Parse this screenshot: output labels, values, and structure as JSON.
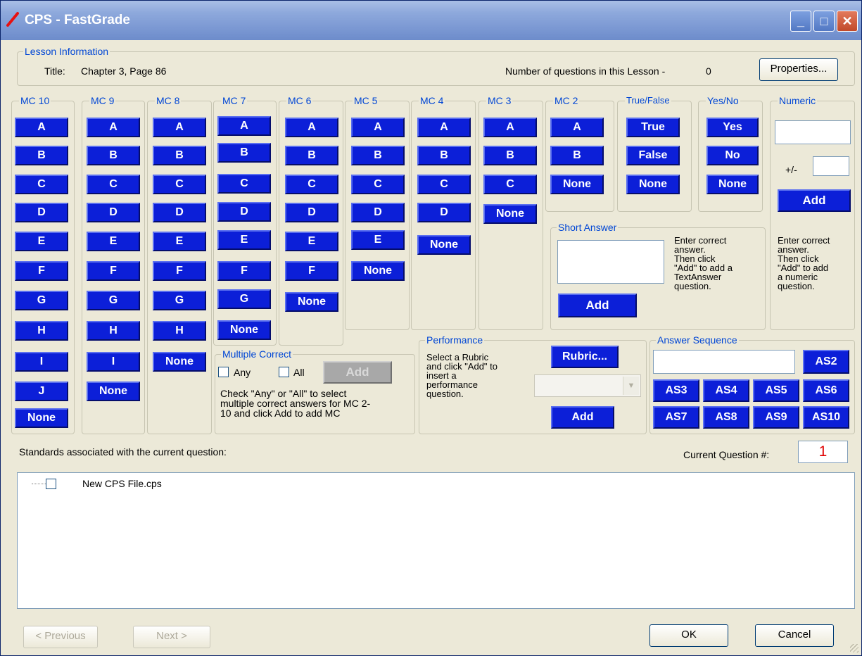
{
  "window": {
    "title": "CPS - FastGrade"
  },
  "lesson": {
    "group_label": "Lesson Information",
    "title_label": "Title:",
    "title_value": "Chapter 3, Page 86",
    "questions_label": "Number of questions in this Lesson -",
    "questions_count": "0",
    "properties_label": "Properties..."
  },
  "mc": {
    "mc10": {
      "label": "MC 10",
      "options": [
        "A",
        "B",
        "C",
        "D",
        "E",
        "F",
        "G",
        "H",
        "I",
        "J",
        "None"
      ]
    },
    "mc9": {
      "label": "MC 9",
      "options": [
        "A",
        "B",
        "C",
        "D",
        "E",
        "F",
        "G",
        "H",
        "I",
        "None"
      ]
    },
    "mc8": {
      "label": "MC 8",
      "options": [
        "A",
        "B",
        "C",
        "D",
        "E",
        "F",
        "G",
        "H",
        "None"
      ]
    },
    "mc7": {
      "label": "MC 7",
      "options": [
        "A",
        "B",
        "C",
        "D",
        "E",
        "F",
        "G",
        "None"
      ]
    },
    "mc6": {
      "label": "MC 6",
      "options": [
        "A",
        "B",
        "C",
        "D",
        "E",
        "F",
        "None"
      ]
    },
    "mc5": {
      "label": "MC 5",
      "options": [
        "A",
        "B",
        "C",
        "D",
        "E",
        "None"
      ]
    },
    "mc4": {
      "label": "MC 4",
      "options": [
        "A",
        "B",
        "C",
        "D",
        "None"
      ]
    },
    "mc3": {
      "label": "MC 3",
      "options": [
        "A",
        "B",
        "C",
        "None"
      ]
    },
    "mc2": {
      "label": "MC 2",
      "options": [
        "A",
        "B",
        "None"
      ]
    }
  },
  "truefalse": {
    "label": "True/False",
    "options": [
      "True",
      "False",
      "None"
    ]
  },
  "yesno": {
    "label": "Yes/No",
    "options": [
      "Yes",
      "No",
      "None"
    ]
  },
  "numeric": {
    "label": "Numeric",
    "plusminus": "+/-",
    "add_label": "Add",
    "help_lines": [
      "Enter correct",
      "answer.",
      "Then click",
      "\"Add\" to add",
      "a numeric",
      "question."
    ]
  },
  "short_answer": {
    "label": "Short Answer",
    "add_label": "Add",
    "help_lines": [
      "Enter correct",
      "answer.",
      "Then click",
      "\"Add\" to add a",
      "TextAnswer",
      "question."
    ]
  },
  "multiple_correct": {
    "label": "Multiple Correct",
    "any_label": "Any",
    "all_label": "All",
    "add_label": "Add",
    "desc_lines": [
      "Check \"Any\" or \"All\" to select",
      "multiple correct answers for MC 2-",
      "10 and click Add to add MC"
    ]
  },
  "performance": {
    "label": "Performance",
    "desc_lines": [
      "Select a Rubric",
      "and click \"Add\" to",
      "insert a",
      "performance",
      "question."
    ],
    "rubric_label": "Rubric...",
    "add_label": "Add"
  },
  "answer_sequence": {
    "label": "Answer Sequence",
    "buttons": [
      "AS2",
      "AS3",
      "AS4",
      "AS5",
      "AS6",
      "AS7",
      "AS8",
      "AS9",
      "AS10"
    ]
  },
  "standards": {
    "label": "Standards associated with the current question:",
    "current_label": "Current Question #:",
    "current_value": "1",
    "tree_item": "New CPS File.cps"
  },
  "footer": {
    "previous": "< Previous",
    "next": "Next >",
    "ok": "OK",
    "cancel": "Cancel"
  },
  "colors": {
    "button_blue": "#0c1fd8",
    "group_label": "#0046d5",
    "current_question": "#e00000"
  }
}
